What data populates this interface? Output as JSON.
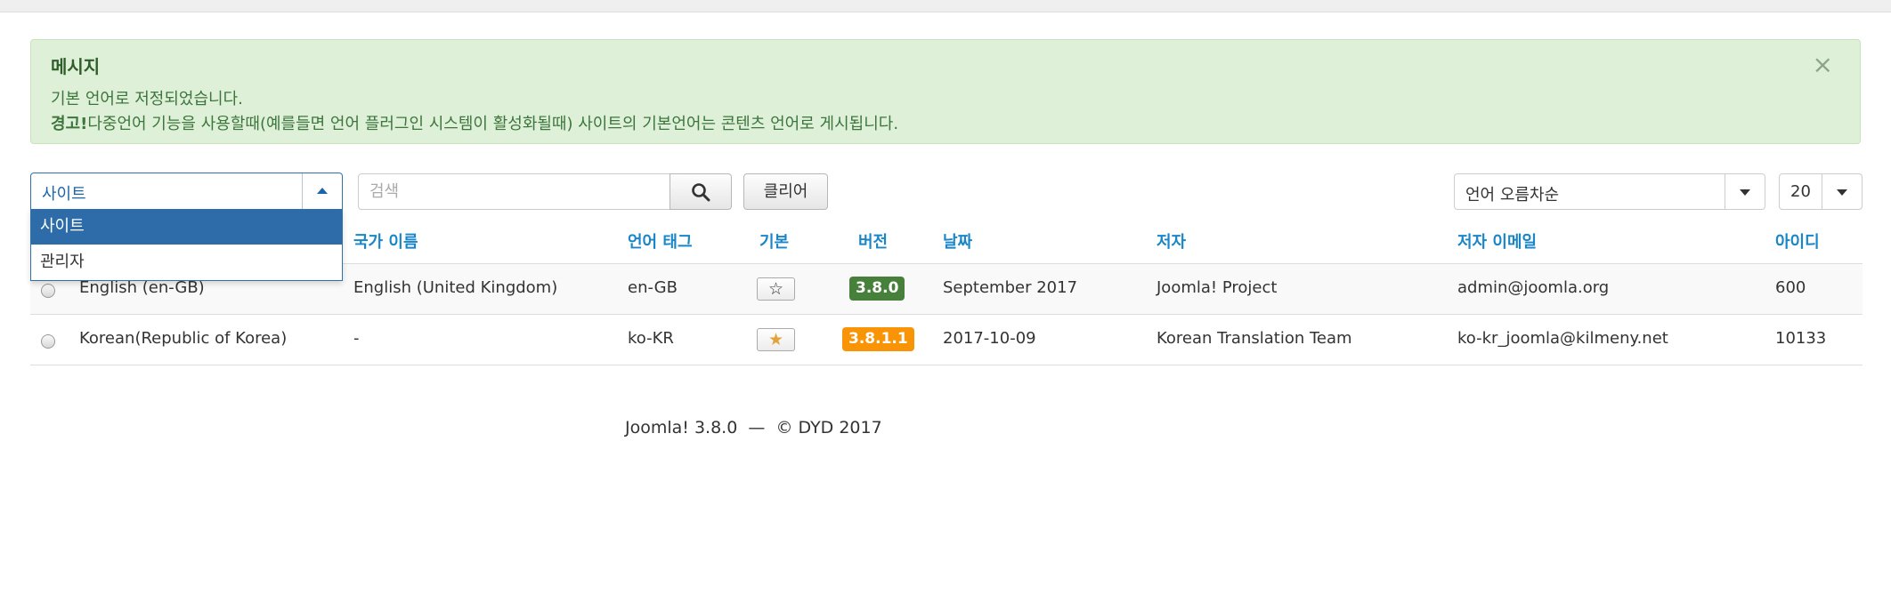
{
  "alert": {
    "heading": "메시지",
    "message": "기본 언어로 저정되었습니다.",
    "warning_bold": "경고!",
    "warning_text": "다중언어 기능을 사용할때(예를들면 언어 플러그인 시스템이 활성화될때) 사이트의 기본언어는 콘텐츠 언어로 게시됩니다.",
    "close_glyph": "×"
  },
  "filters": {
    "client_selected": "사이트",
    "client_options": [
      "사이트",
      "관리자"
    ],
    "search_placeholder": "검색",
    "clear_label": "클리어",
    "sort_selected": "언어 오름차순",
    "limit_selected": "20"
  },
  "table": {
    "headers": {
      "country_name": "국가 이름",
      "lang_tag": "언어 태그",
      "default": "기본",
      "version": "버전",
      "date": "날짜",
      "author": "저자",
      "author_email": "저자 이메일",
      "id": "아이디"
    },
    "rows": [
      {
        "title": "English (en-GB)",
        "country": "English (United Kingdom)",
        "tag": "en-GB",
        "default": false,
        "version": "3.8.0",
        "version_color": "#46803a",
        "date": "September 2017",
        "author": "Joomla! Project",
        "email": "admin@joomla.org",
        "id": "600"
      },
      {
        "title": "Korean(Republic of Korea)",
        "country": "-",
        "tag": "ko-KR",
        "default": true,
        "version": "3.8.1.1",
        "version_color": "#f89406",
        "date": "2017-10-09",
        "author": "Korean Translation Team",
        "email": "ko-kr_joomla@kilmeny.net",
        "id": "10133"
      }
    ]
  },
  "footer": {
    "text": "Joomla! 3.8.0  —  © DYD 2017"
  },
  "icons": {
    "search": "search-icon",
    "star_empty": "star-empty-icon",
    "star_filled": "star-filled-icon",
    "close": "close-icon"
  },
  "colors": {
    "link_blue": "#1a86c8",
    "alert_bg": "#dff0d8",
    "alert_text": "#3c763d",
    "dropdown_selected": "#2d6ca8",
    "star_filled": "#e3a33a"
  }
}
